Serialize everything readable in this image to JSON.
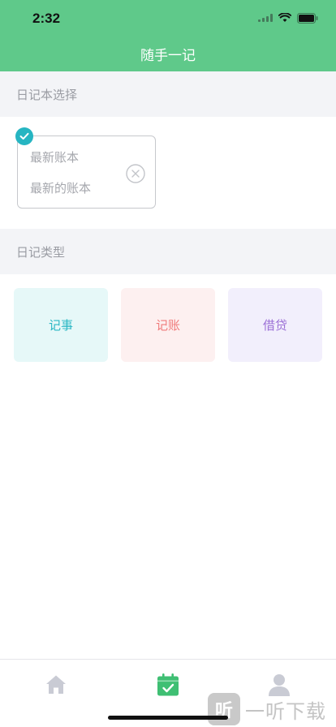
{
  "status_bar": {
    "time": "2:32"
  },
  "nav": {
    "title": "随手一记"
  },
  "notebook_section": {
    "title": "日记本选择",
    "selected_notebook": {
      "name": "最新账本",
      "description": "最新的账本"
    }
  },
  "type_section": {
    "title": "日记类型",
    "types": [
      {
        "label": "记事",
        "color": "#2bb7c4",
        "bg": "#e6f8f8"
      },
      {
        "label": "记账",
        "color": "#f07c7c",
        "bg": "#fdf0f0"
      },
      {
        "label": "借贷",
        "color": "#9b6fd6",
        "bg": "#f2effc"
      }
    ]
  },
  "tabbar": {
    "tabs": [
      {
        "icon": "home-icon",
        "active": false
      },
      {
        "icon": "calendar-check-icon",
        "active": true
      },
      {
        "icon": "user-icon",
        "active": false
      }
    ],
    "active_color": "#3fbf73",
    "inactive_color": "#c9cbd4"
  },
  "watermark": {
    "badge": "听",
    "text": "一听下载"
  },
  "colors": {
    "header": "#5fc98a",
    "accent": "#26b5c2"
  }
}
